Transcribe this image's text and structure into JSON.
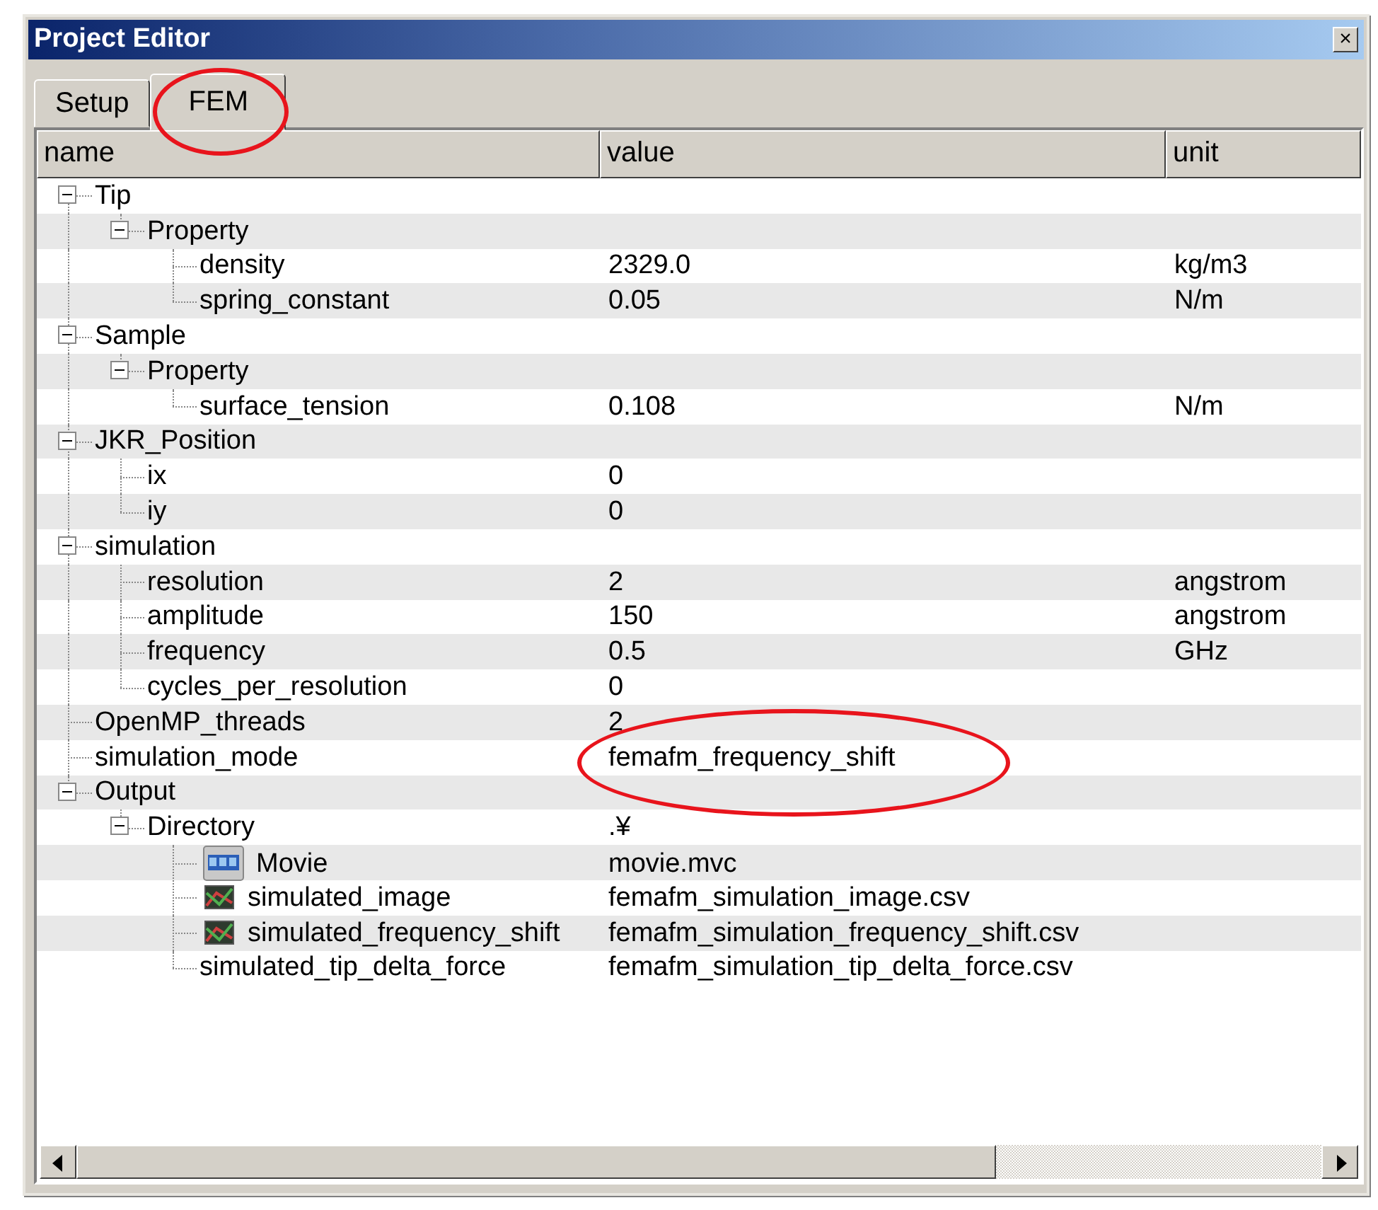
{
  "window": {
    "title": "Project Editor",
    "close": "×"
  },
  "tabs": [
    {
      "label": "Setup",
      "selected": false,
      "circled": false
    },
    {
      "label": "FEM",
      "selected": true,
      "circled": true
    }
  ],
  "columns": [
    "name",
    "value",
    "unit"
  ],
  "tree": [
    {
      "name": "Tip",
      "expanded": true,
      "children": [
        {
          "name": "Property",
          "expanded": true,
          "children": [
            {
              "name": "density",
              "value": "2329.0",
              "unit": "kg/m3"
            },
            {
              "name": "spring_constant",
              "value": "0.05",
              "unit": "N/m"
            }
          ]
        }
      ]
    },
    {
      "name": "Sample",
      "expanded": true,
      "children": [
        {
          "name": "Property",
          "expanded": true,
          "children": [
            {
              "name": "surface_tension",
              "value": "0.108",
              "unit": "N/m"
            }
          ]
        }
      ]
    },
    {
      "name": "JKR_Position",
      "expanded": true,
      "children": [
        {
          "name": "ix",
          "value": "0"
        },
        {
          "name": "iy",
          "value": "0"
        }
      ]
    },
    {
      "name": "simulation",
      "expanded": true,
      "children": [
        {
          "name": "resolution",
          "value": "2",
          "unit": "angstrom"
        },
        {
          "name": "amplitude",
          "value": "150",
          "unit": "angstrom"
        },
        {
          "name": "frequency",
          "value": "0.5",
          "unit": "GHz"
        },
        {
          "name": "cycles_per_resolution",
          "value": "0"
        }
      ]
    },
    {
      "name": "OpenMP_threads",
      "value": "2"
    },
    {
      "name": "simulation_mode",
      "value": "femafm_frequency_shift",
      "circled": true
    },
    {
      "name": "Output",
      "expanded": true,
      "children": [
        {
          "name": "Directory",
          "value": ".¥",
          "expanded": true,
          "children": [
            {
              "name": "Movie",
              "value": "movie.mvc",
              "kind": "movie"
            },
            {
              "name": "simulated_image",
              "value": "femafm_simulation_image.csv",
              "kind": "image"
            },
            {
              "name": "simulated_frequency_shift",
              "value": "femafm_simulation_frequency_shift.csv",
              "kind": "image"
            },
            {
              "name": "simulated_tip_delta_force",
              "value": "femafm_simulation_tip_delta_force.csv",
              "kind": "plain"
            }
          ]
        }
      ]
    }
  ]
}
